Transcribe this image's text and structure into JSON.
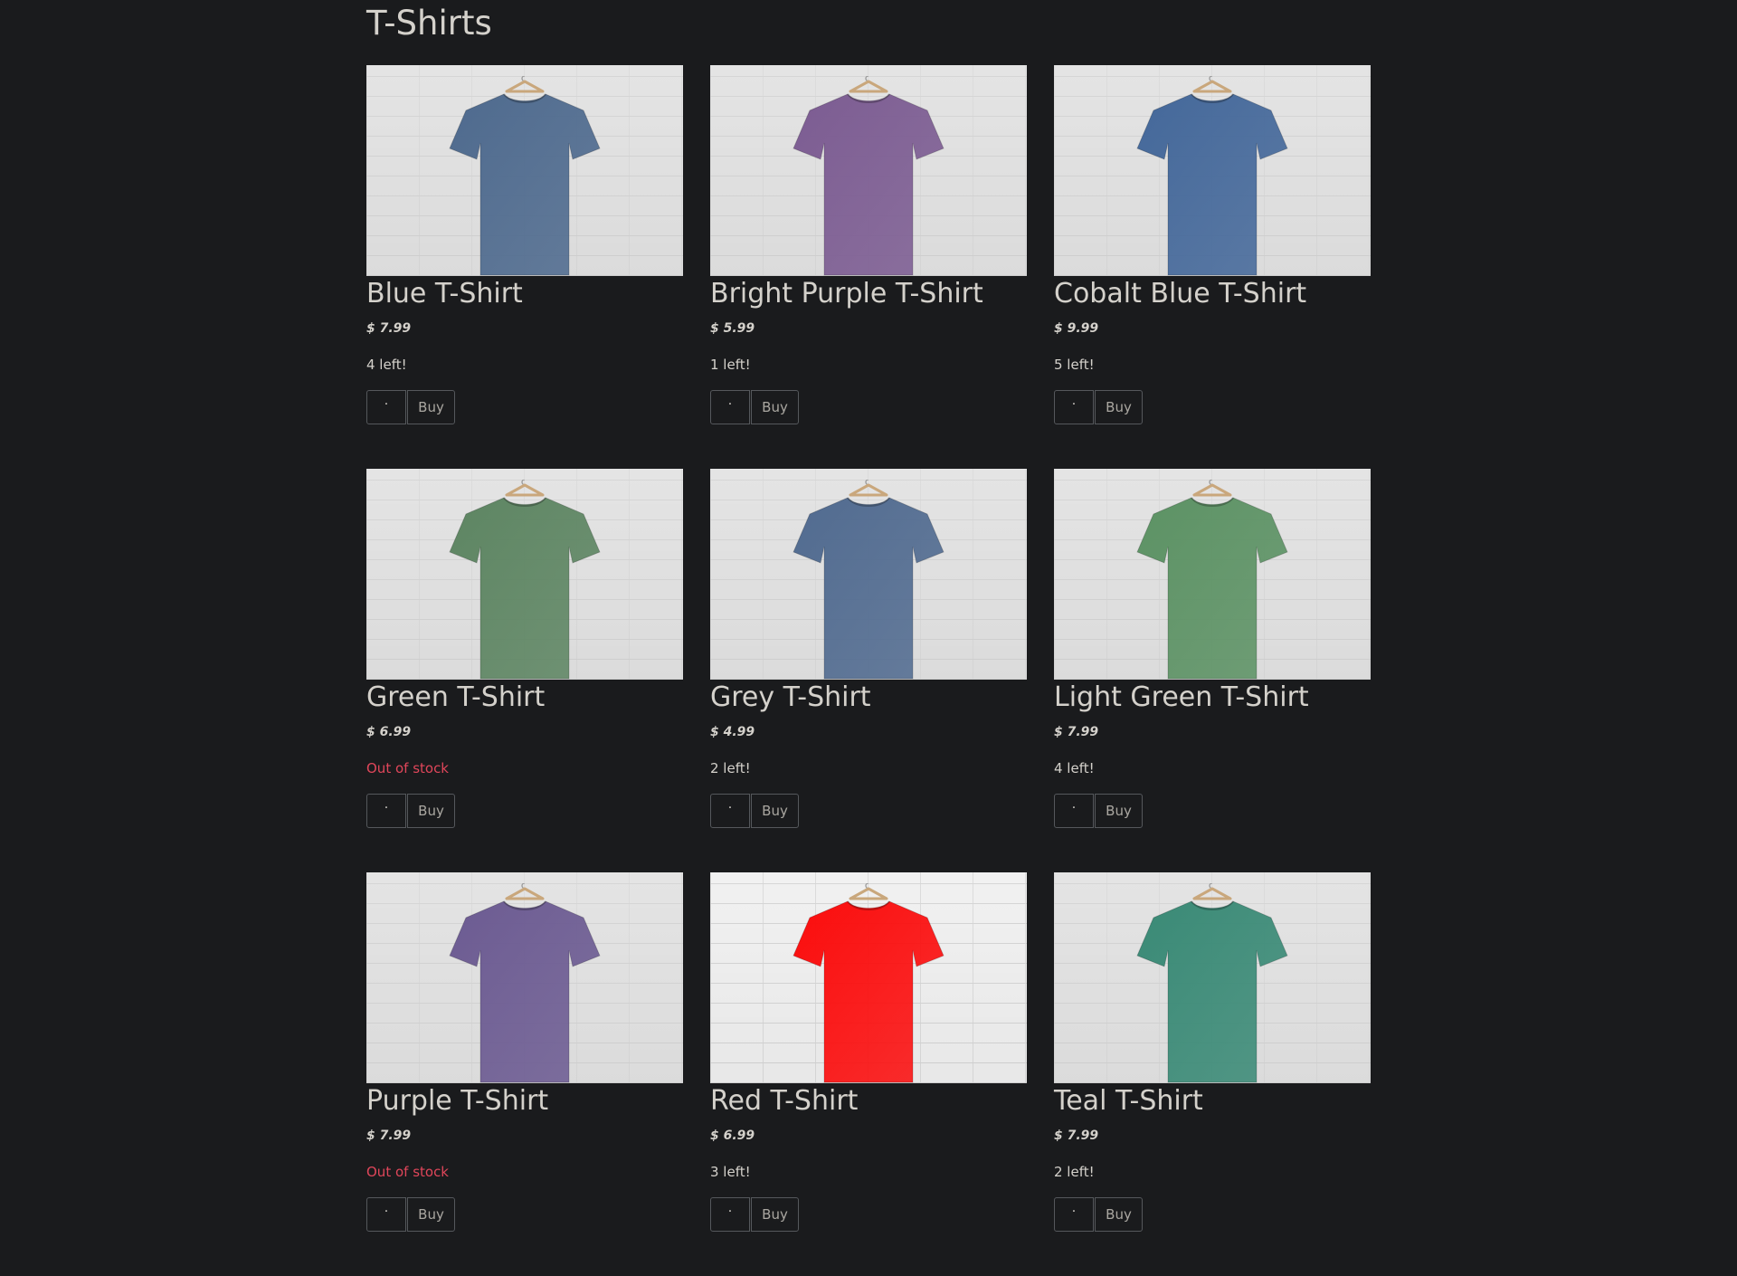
{
  "page": {
    "title": "T-Shirts"
  },
  "products": [
    {
      "name": "Blue T-Shirt",
      "price": "$ 7.99",
      "stock": "4 left!",
      "in_stock": true,
      "qty": "·",
      "buy_label": "Buy",
      "shirt_color": "#4e6a8e",
      "shirt_icon": "blue-tshirt-image"
    },
    {
      "name": "Bright Purple T-Shirt",
      "price": "$ 5.99",
      "stock": "1 left!",
      "in_stock": true,
      "qty": "·",
      "buy_label": "Buy",
      "shirt_color": "#7c5c92",
      "shirt_icon": "bright-purple-tshirt-image"
    },
    {
      "name": "Cobalt Blue T-Shirt",
      "price": "$ 9.99",
      "stock": "5 left!",
      "in_stock": true,
      "qty": "·",
      "buy_label": "Buy",
      "shirt_color": "#44689a",
      "shirt_icon": "cobalt-blue-tshirt-image"
    },
    {
      "name": "Green T-Shirt",
      "price": "$ 6.99",
      "stock": "Out of stock",
      "in_stock": false,
      "qty": "·",
      "buy_label": "Buy",
      "shirt_color": "#5d8562",
      "shirt_icon": "green-tshirt-image"
    },
    {
      "name": "Grey T-Shirt",
      "price": "$ 4.99",
      "stock": "2 left!",
      "in_stock": true,
      "qty": "·",
      "buy_label": "Buy",
      "shirt_color": "#516b90",
      "shirt_icon": "grey-tshirt-image"
    },
    {
      "name": "Light Green T-Shirt",
      "price": "$ 7.99",
      "stock": "4 left!",
      "in_stock": true,
      "qty": "·",
      "buy_label": "Buy",
      "shirt_color": "#5c9264",
      "shirt_icon": "light-green-tshirt-image"
    },
    {
      "name": "Purple T-Shirt",
      "price": "$ 7.99",
      "stock": "Out of stock",
      "in_stock": false,
      "qty": "·",
      "buy_label": "Buy",
      "shirt_color": "#6c5b92",
      "shirt_icon": "purple-tshirt-image"
    },
    {
      "name": "Red T-Shirt",
      "price": "$ 6.99",
      "stock": "3 left!",
      "in_stock": true,
      "qty": "·",
      "buy_label": "Buy",
      "shirt_color": "#fb0d0d",
      "shirt_icon": "red-tshirt-image"
    },
    {
      "name": "Teal T-Shirt",
      "price": "$ 7.99",
      "stock": "2 left!",
      "in_stock": true,
      "qty": "·",
      "buy_label": "Buy",
      "shirt_color": "#3a8a76",
      "shirt_icon": "teal-tshirt-image"
    }
  ],
  "colors": {
    "background": "#1a1b1d",
    "text": "#d4d1cb",
    "out_of_stock": "#e0465a",
    "border": "#55585c"
  }
}
